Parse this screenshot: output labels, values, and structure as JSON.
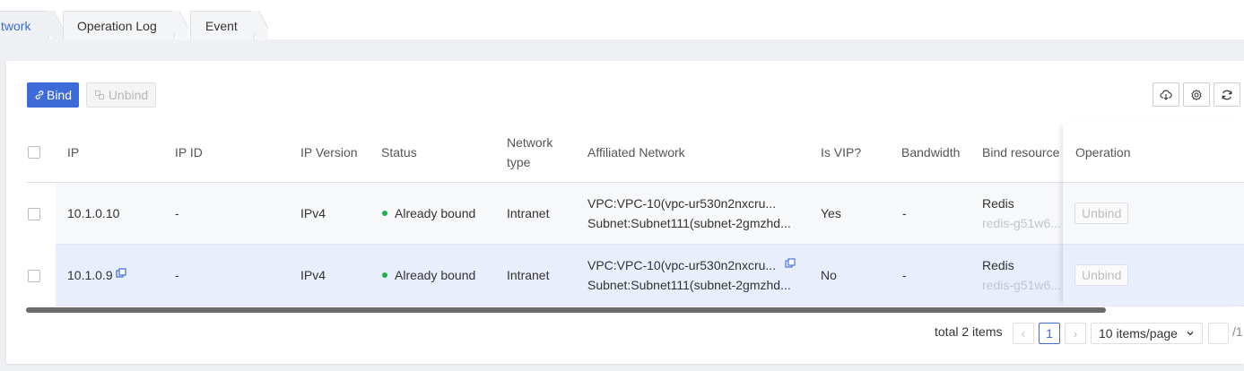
{
  "tabs": [
    {
      "label": "twork",
      "active": true
    },
    {
      "label": "Operation Log",
      "active": false
    },
    {
      "label": "Event",
      "active": false
    }
  ],
  "toolbar": {
    "bind_label": "Bind",
    "unbind_label": "Unbind",
    "icons": [
      "cloud-download-icon",
      "gear-icon",
      "refresh-icon"
    ]
  },
  "table": {
    "columns": {
      "ip": "IP",
      "ip_id": "IP ID",
      "ip_version": "IP Version",
      "status": "Status",
      "network_type_l1": "Network",
      "network_type_l2": "type",
      "affiliated_network": "Affiliated Network",
      "is_vip": "Is VIP?",
      "bandwidth": "Bandwidth",
      "bind_resources": "Bind resource",
      "operation": "Operation"
    },
    "rows": [
      {
        "ip": "10.1.0.10",
        "ip_id": "-",
        "ip_version": "IPv4",
        "status": "Already bound",
        "network_type": "Intranet",
        "vpc": "VPC:VPC-10(vpc-ur530n2nxcru...",
        "subnet": "Subnet:Subnet111(subnet-2gmzhd...",
        "is_vip": "Yes",
        "bandwidth": "-",
        "resource_name": "Redis",
        "resource_id": "redis-g51w6...",
        "operation": "Unbind"
      },
      {
        "ip": "10.1.0.9",
        "ip_id": "-",
        "ip_version": "IPv4",
        "status": "Already bound",
        "network_type": "Intranet",
        "vpc": "VPC:VPC-10(vpc-ur530n2nxcru...",
        "subnet": "Subnet:Subnet111(subnet-2gmzhd...",
        "is_vip": "No",
        "bandwidth": "-",
        "resource_name": "Redis",
        "resource_id": "redis-g51w6...",
        "operation": "Unbind"
      }
    ]
  },
  "pagination": {
    "total_text": "total 2 items",
    "prev": "‹",
    "current_page": "1",
    "next": "›",
    "page_size": "10 items/page",
    "total_pages": "/1"
  },
  "colors": {
    "accent": "#3d6bd8",
    "status_ok": "#21b04b",
    "row_hover": "#e9eefc"
  }
}
